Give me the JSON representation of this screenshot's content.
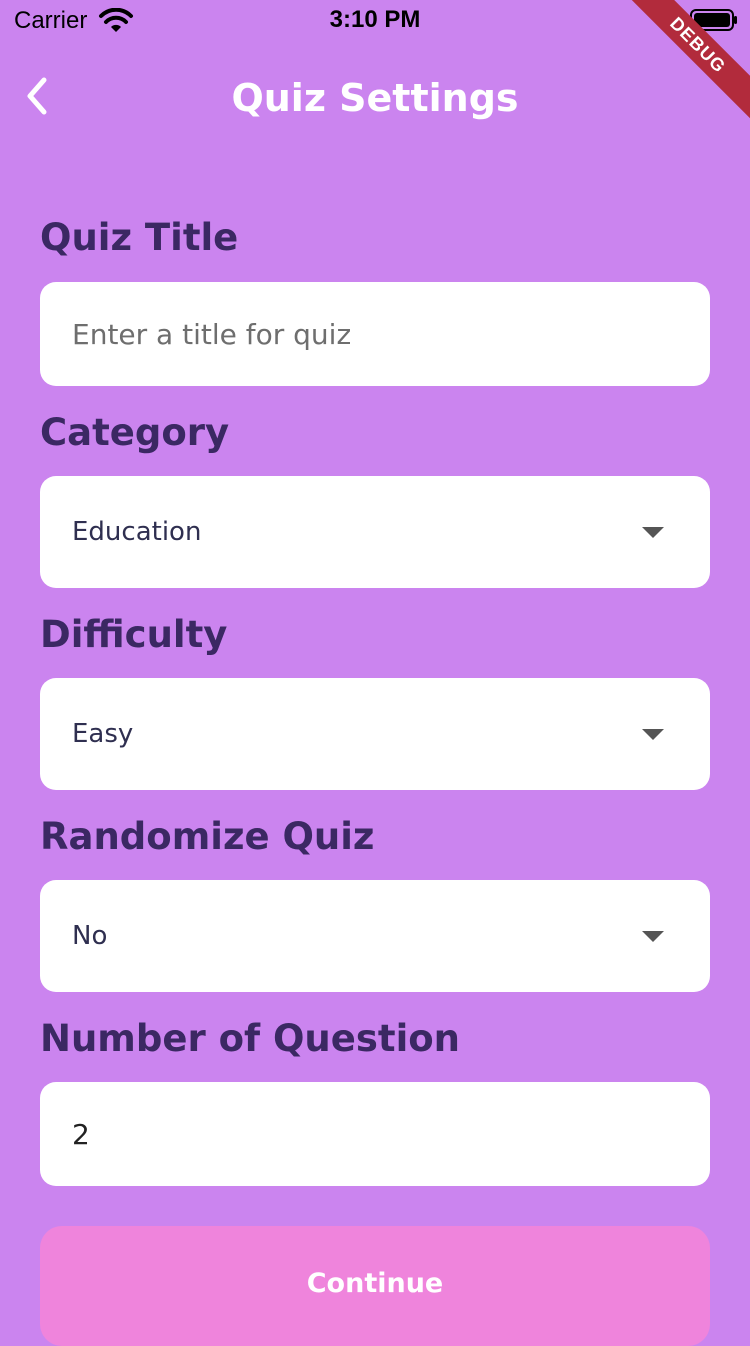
{
  "status_bar": {
    "carrier": "Carrier",
    "time": "3:10 PM"
  },
  "debug_banner": "DEBUG",
  "header": {
    "title": "Quiz Settings",
    "back_icon": "chevron-left-icon"
  },
  "form": {
    "quiz_title": {
      "label": "Quiz Title",
      "placeholder": "Enter a title for quiz",
      "value": ""
    },
    "category": {
      "label": "Category",
      "value": "Education"
    },
    "difficulty": {
      "label": "Difficulty",
      "value": "Easy"
    },
    "randomize": {
      "label": "Randomize Quiz",
      "value": "No"
    },
    "num_questions": {
      "label": "Number of Question",
      "value": "2"
    }
  },
  "continue_label": "Continue",
  "colors": {
    "background": "#cb84ef",
    "label": "#3b2863",
    "button": "#ef84dc",
    "debug_ribbon": "#b22b3c"
  }
}
